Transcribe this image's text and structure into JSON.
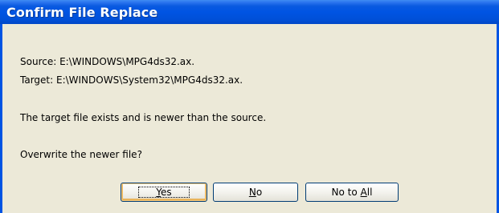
{
  "window": {
    "title": "Confirm File Replace"
  },
  "dialog": {
    "source_line": "Source: E:\\WINDOWS\\MPG4ds32.ax.",
    "target_line": "Target: E:\\WINDOWS\\System32\\MPG4ds32.ax.",
    "message": "The target file exists and is newer than the source.",
    "question": "Overwrite the newer file?"
  },
  "buttons": {
    "yes": {
      "mnemonic": "Y",
      "rest": "es"
    },
    "no": {
      "mnemonic": "N",
      "rest": "o"
    },
    "no_to_all": {
      "prefix": "No to ",
      "mnemonic": "A",
      "rest": "ll"
    }
  },
  "colors": {
    "titlebar": "#0054e3",
    "dialog_background": "#ece9d8",
    "button_border": "#003c74"
  }
}
